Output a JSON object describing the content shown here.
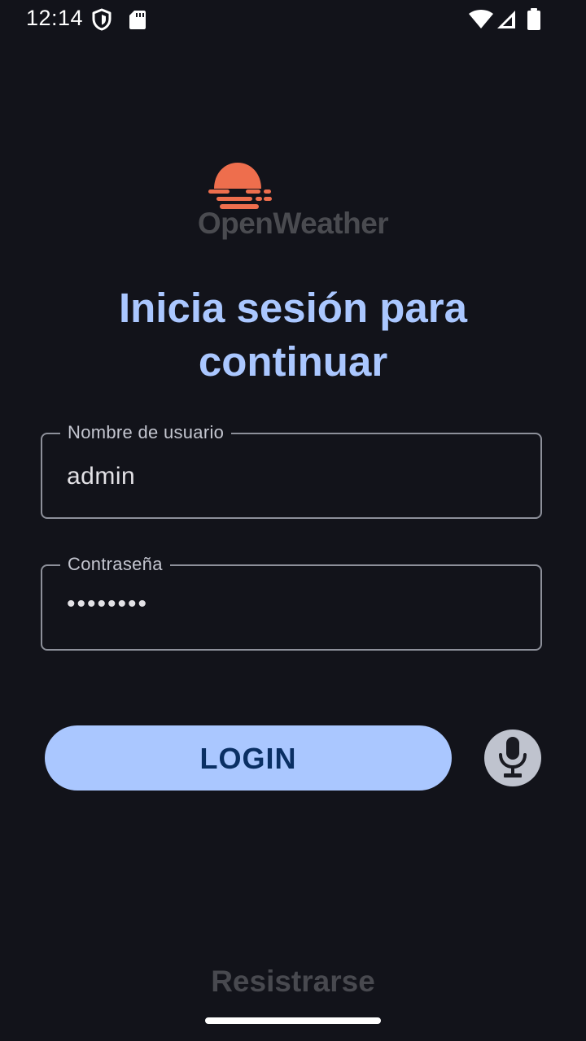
{
  "status_bar": {
    "time": "12:14",
    "icons": [
      "shield-icon",
      "sd-card-icon",
      "wifi-icon",
      "signal-icon",
      "battery-icon"
    ]
  },
  "logo": {
    "text": "OpenWeather",
    "accent_color": "#ee6e4d"
  },
  "heading": "Inicia sesión para continuar",
  "username_field": {
    "label": "Nombre de usuario",
    "value": "admin"
  },
  "password_field": {
    "label": "Contraseña",
    "value": "••••••••"
  },
  "login_button": {
    "label": "LOGIN"
  },
  "mic_button": {
    "icon": "microphone-icon"
  },
  "register_link": "Resistrarse",
  "colors": {
    "background": "#12131a",
    "primary": "#aac7ff",
    "on_primary": "#0a2f63",
    "outline": "#8d909a"
  }
}
